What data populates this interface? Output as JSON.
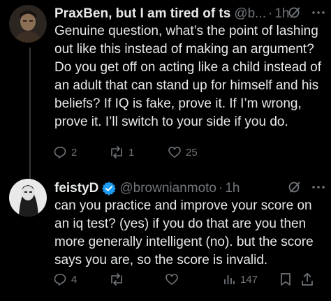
{
  "tweets": [
    {
      "display_name": "PraxBen, but I am tired of ts",
      "handle": "@b...",
      "time": "1h",
      "body": "Genuine question, what’s the point of lashing out like this instead of making an argument? Do you get off on acting like a child instead of an adult that can stand up for himself and his beliefs? If IQ is fake, prove it. If I’m wrong, prove it. I’ll switch to your side if you do.",
      "replies": "2",
      "reposts": "1",
      "likes": "25"
    },
    {
      "display_name": "feistyD",
      "handle": "@brownianmoto",
      "time": "1h",
      "verified": true,
      "body": "can you practice and improve your score on an iq test? (yes) if you do that are you then more generally intelligent (no). but the score says you are, so the score is invalid.",
      "replies": "4",
      "reposts": "",
      "likes": "",
      "views": "147"
    }
  ],
  "separator": "·",
  "colors": {
    "background": "#000000",
    "text": "#e7e9ea",
    "secondary": "#71767b",
    "verified": "#1d9bf0",
    "thread_line": "#333639"
  },
  "icons": [
    "grok-icon",
    "more-icon",
    "reply-icon",
    "repost-icon",
    "like-icon",
    "views-icon",
    "bookmark-icon",
    "share-icon",
    "verified-badge-icon"
  ]
}
